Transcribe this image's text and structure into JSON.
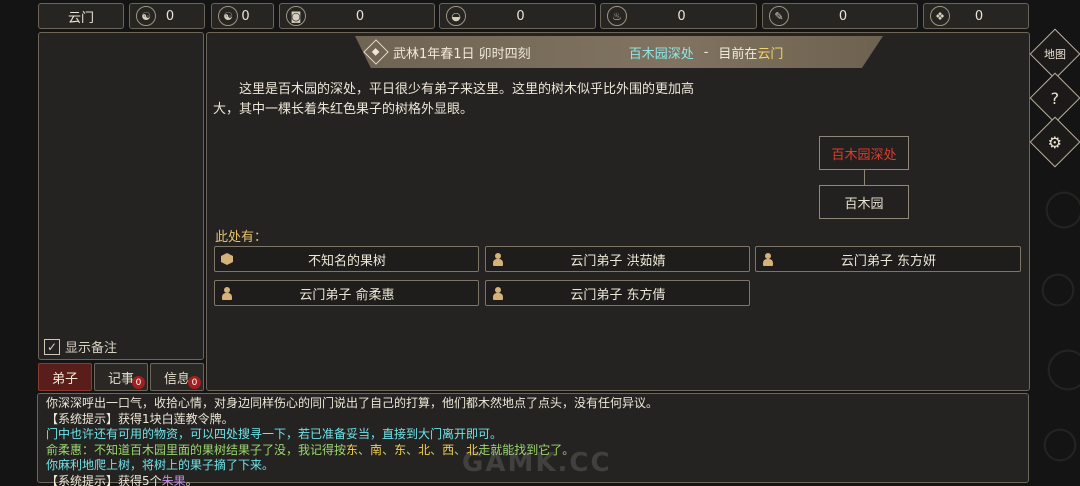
{
  "topbar": {
    "sect_label": "云门",
    "resources": [
      {
        "icon": "taiji-coin-icon",
        "glyph": "☯",
        "value": "0"
      },
      {
        "icon": "yin-yang-icon",
        "glyph": "☯",
        "value": "0"
      },
      {
        "icon": "square-coin-icon",
        "glyph": "◙",
        "value": "0"
      },
      {
        "icon": "rice-bowl-icon",
        "glyph": "◒",
        "value": "0"
      },
      {
        "icon": "gourd-icon",
        "glyph": "♨",
        "value": "0"
      },
      {
        "icon": "scroll-icon",
        "glyph": "✎",
        "value": "0"
      },
      {
        "icon": "ore-icon",
        "glyph": "❖",
        "value": "0"
      }
    ]
  },
  "left_panel": {
    "memo_toggle_label": "显示备注",
    "check_glyph": "✓",
    "tabs": [
      {
        "label": "弟子",
        "badge": ""
      },
      {
        "label": "记事",
        "badge": "0"
      },
      {
        "label": "信息",
        "badge": "0"
      }
    ]
  },
  "header": {
    "icon_glyph": "◆",
    "date": "武林1年春1日 卯时四刻",
    "location": "百木园深处",
    "dash": "-",
    "now_prefix": "目前在",
    "now_place": "云门"
  },
  "description": "这里是百木园的深处，平日很少有弟子来这里。这里的树木似乎比外围的更加高大，其中一棵长着朱红色果子的树格外显眼。",
  "mini_map": {
    "current": "百木园深处",
    "current_color": "#e03a2a",
    "exit": "百木园"
  },
  "here": {
    "label": "此处有：",
    "entities": [
      {
        "type": "object",
        "label": "不知名的果树"
      },
      {
        "type": "person",
        "label": "云门弟子  洪茹婧"
      },
      {
        "type": "person",
        "label": "云门弟子  东方妍"
      },
      {
        "type": "person",
        "label": "云门弟子  俞柔惠"
      },
      {
        "type": "person",
        "label": "云门弟子  东方倩"
      }
    ]
  },
  "side_buttons": [
    {
      "icon": "map-icon",
      "glyph": "地图"
    },
    {
      "icon": "help-icon",
      "glyph": "?"
    },
    {
      "icon": "settings-gear-icon",
      "glyph": "⚙"
    }
  ],
  "log": {
    "line1": "你深深呼出一口气，收拾心情，对身边同样伤心的同门说出了自己的打算，他们都木然地点了点头，没有任何异议。",
    "line2": "【系统提示】获得1块白莲教令牌。",
    "line3": "门中也许还有可用的物资，可以四处搜寻一下，若已准备妥当，直接到大门离开即可。",
    "line4_prefix": "俞柔惠：不知道百木园里面的果树结果子了没，我记得按",
    "line4_dirs": [
      "东",
      "南",
      "东",
      "北",
      "西",
      "北"
    ],
    "line4_sep": "、",
    "line4_suffix": "走就能找到它了。",
    "line5": "你麻利地爬上树，将树上的果子摘了下来。",
    "line6_prefix": "【系统提示】获得5个",
    "line6_item": "朱果",
    "line6_suffix": "。"
  },
  "watermark": "GAMK.CC"
}
